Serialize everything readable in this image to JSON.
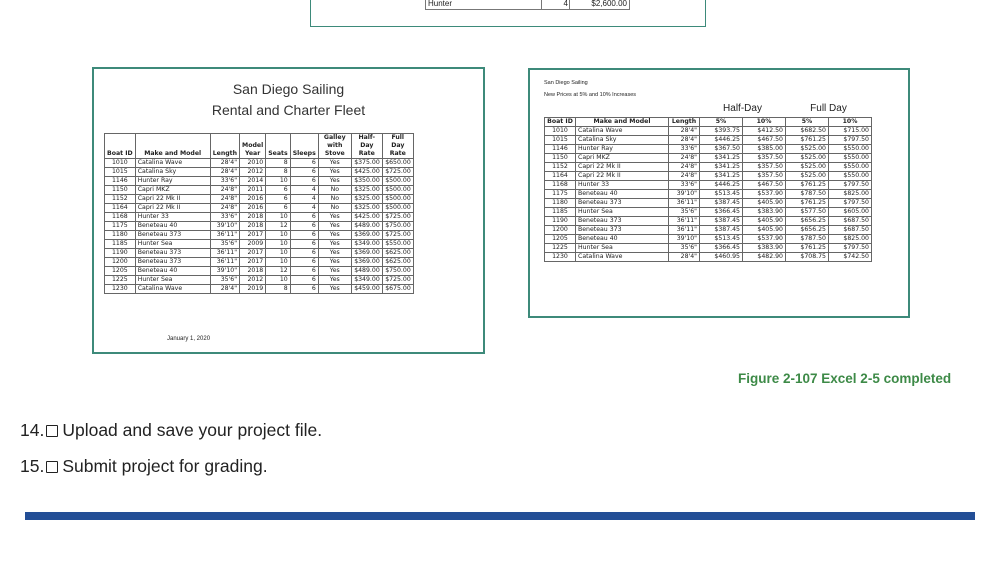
{
  "top_sheet": {
    "name": "Hunter",
    "count": "4",
    "amount": "$2,600.00"
  },
  "left_sheet": {
    "title": "San Diego Sailing",
    "subtitle": "Rental and Charter Fleet",
    "headers": [
      "Boat ID",
      "Make and Model",
      "Length",
      "Model Year",
      "Seats",
      "Sleeps",
      "Galley with Stove",
      "Half-Day Rate",
      "Full Day Rate"
    ],
    "rows": [
      [
        "1010",
        "Catalina Wave",
        "28'4\"",
        "2010",
        "8",
        "6",
        "Yes",
        "$375.00",
        "$650.00"
      ],
      [
        "1015",
        "Catalina Sky",
        "28'4\"",
        "2012",
        "8",
        "6",
        "Yes",
        "$425.00",
        "$725.00"
      ],
      [
        "1146",
        "Hunter Ray",
        "33'6\"",
        "2014",
        "10",
        "6",
        "Yes",
        "$350.00",
        "$500.00"
      ],
      [
        "1150",
        "Capri MKZ",
        "24'8\"",
        "2011",
        "6",
        "4",
        "No",
        "$325.00",
        "$500.00"
      ],
      [
        "1152",
        "Capri 22 Mk II",
        "24'8\"",
        "2016",
        "6",
        "4",
        "No",
        "$325.00",
        "$500.00"
      ],
      [
        "1164",
        "Capri 22 Mk II",
        "24'8\"",
        "2016",
        "6",
        "4",
        "No",
        "$325.00",
        "$500.00"
      ],
      [
        "1168",
        "Hunter 33",
        "33'6\"",
        "2018",
        "10",
        "6",
        "Yes",
        "$425.00",
        "$725.00"
      ],
      [
        "1175",
        "Beneteau 40",
        "39'10\"",
        "2018",
        "12",
        "6",
        "Yes",
        "$489.00",
        "$750.00"
      ],
      [
        "1180",
        "Beneteau 373",
        "36'11\"",
        "2017",
        "10",
        "6",
        "Yes",
        "$369.00",
        "$725.00"
      ],
      [
        "1185",
        "Hunter Sea",
        "35'6\"",
        "2009",
        "10",
        "6",
        "Yes",
        "$349.00",
        "$550.00"
      ],
      [
        "1190",
        "Beneteau 373",
        "36'11\"",
        "2017",
        "10",
        "6",
        "Yes",
        "$369.00",
        "$625.00"
      ],
      [
        "1200",
        "Beneteau 373",
        "36'11\"",
        "2017",
        "10",
        "6",
        "Yes",
        "$369.00",
        "$625.00"
      ],
      [
        "1205",
        "Beneteau 40",
        "39'10\"",
        "2018",
        "12",
        "6",
        "Yes",
        "$489.00",
        "$750.00"
      ],
      [
        "1225",
        "Hunter Sea",
        "35'6\"",
        "2012",
        "10",
        "6",
        "Yes",
        "$349.00",
        "$725.00"
      ],
      [
        "1230",
        "Catalina Wave",
        "28'4\"",
        "2019",
        "8",
        "6",
        "Yes",
        "$459.00",
        "$675.00"
      ]
    ],
    "date": "January 1, 2020"
  },
  "right_sheet": {
    "title": "San Diego Sailing",
    "subtitle": "New Prices at 5% and 10% Increases",
    "group_half": "Half-Day",
    "group_full": "Full Day",
    "headers": [
      "Boat ID",
      "Make and Model",
      "Length",
      "5%",
      "10%",
      "5%",
      "10%"
    ],
    "rows": [
      [
        "1010",
        "Catalina Wave",
        "28'4\"",
        "$393.75",
        "$412.50",
        "$682.50",
        "$715.00"
      ],
      [
        "1015",
        "Catalina Sky",
        "28'4\"",
        "$446.25",
        "$467.50",
        "$761.25",
        "$797.50"
      ],
      [
        "1146",
        "Hunter Ray",
        "33'6\"",
        "$367.50",
        "$385.00",
        "$525.00",
        "$550.00"
      ],
      [
        "1150",
        "Capri MKZ",
        "24'8\"",
        "$341.25",
        "$357.50",
        "$525.00",
        "$550.00"
      ],
      [
        "1152",
        "Capri 22 Mk II",
        "24'8\"",
        "$341.25",
        "$357.50",
        "$525.00",
        "$550.00"
      ],
      [
        "1164",
        "Capri 22 Mk II",
        "24'8\"",
        "$341.25",
        "$357.50",
        "$525.00",
        "$550.00"
      ],
      [
        "1168",
        "Hunter 33",
        "33'6\"",
        "$446.25",
        "$467.50",
        "$761.25",
        "$797.50"
      ],
      [
        "1175",
        "Beneteau 40",
        "39'10\"",
        "$513.45",
        "$537.90",
        "$787.50",
        "$825.00"
      ],
      [
        "1180",
        "Beneteau 373",
        "36'11\"",
        "$387.45",
        "$405.90",
        "$761.25",
        "$797.50"
      ],
      [
        "1185",
        "Hunter Sea",
        "35'6\"",
        "$366.45",
        "$383.90",
        "$577.50",
        "$605.00"
      ],
      [
        "1190",
        "Beneteau 373",
        "36'11\"",
        "$387.45",
        "$405.90",
        "$656.25",
        "$687.50"
      ],
      [
        "1200",
        "Beneteau 373",
        "36'11\"",
        "$387.45",
        "$405.90",
        "$656.25",
        "$687.50"
      ],
      [
        "1205",
        "Beneteau 40",
        "39'10\"",
        "$513.45",
        "$537.90",
        "$787.50",
        "$825.00"
      ],
      [
        "1225",
        "Hunter Sea",
        "35'6\"",
        "$366.45",
        "$383.90",
        "$761.25",
        "$797.50"
      ],
      [
        "1230",
        "Catalina Wave",
        "28'4\"",
        "$460.95",
        "$482.90",
        "$708.75",
        "$742.50"
      ]
    ]
  },
  "caption": "Figure 2-107 Excel 2-5 completed",
  "steps": [
    {
      "number": "14.",
      "label": "Upload and save your project file."
    },
    {
      "number": "15.",
      "label": "Submit project for grading."
    }
  ],
  "colors": {
    "divider": "#234e96",
    "caption": "#3d8a47",
    "sheet_border": "#3d8a7a"
  }
}
